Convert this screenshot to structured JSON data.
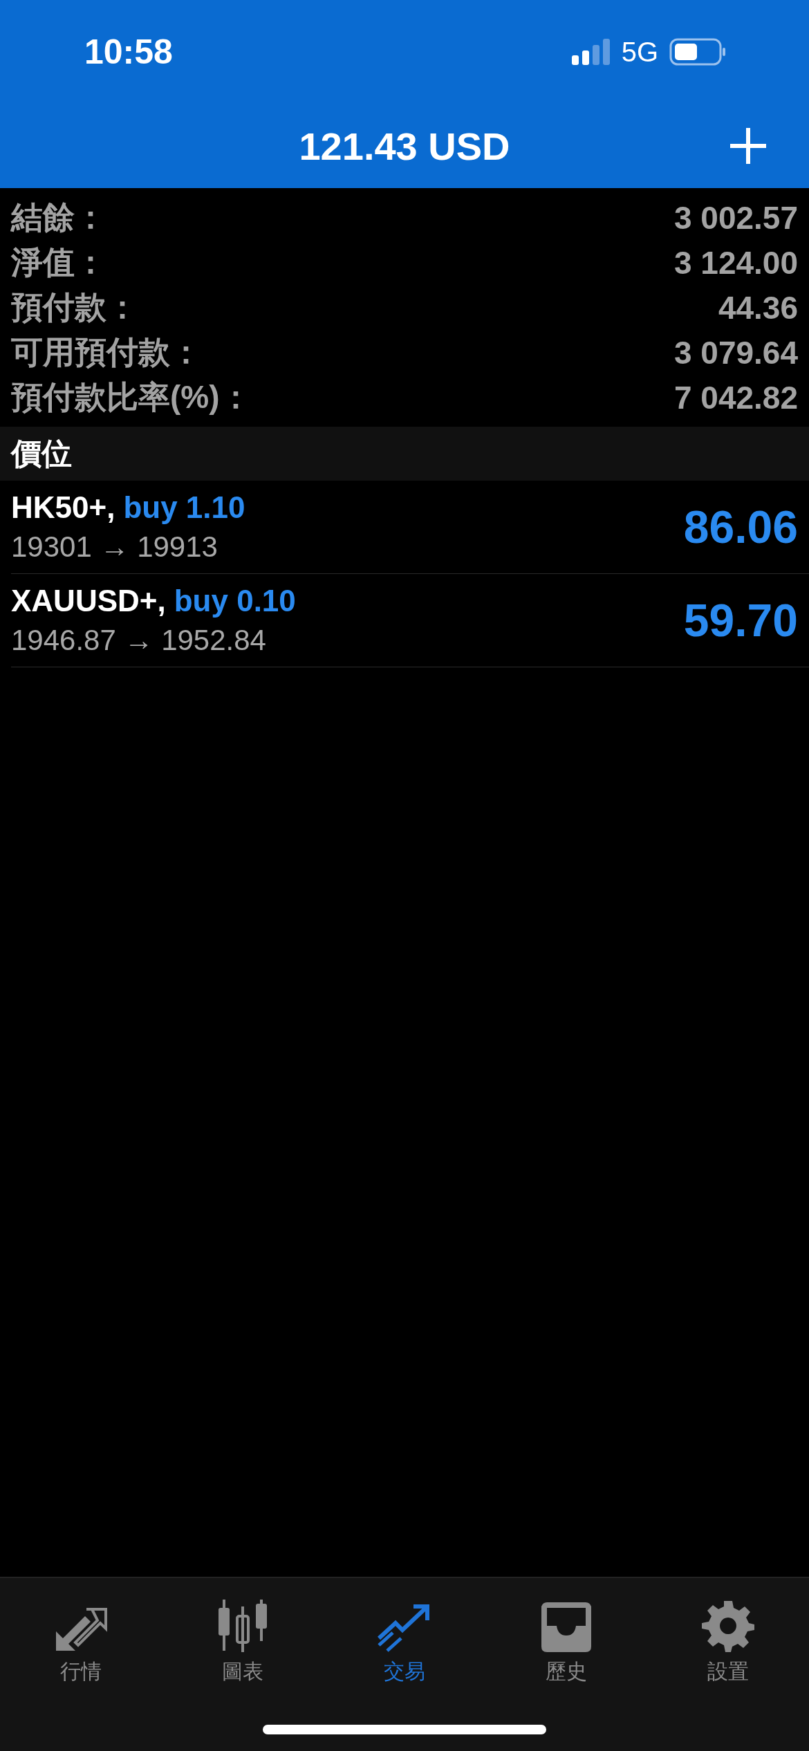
{
  "status_bar": {
    "time": "10:58",
    "network": "5G"
  },
  "header": {
    "title": "121.43 USD"
  },
  "account": [
    {
      "label": "結餘：",
      "value": "3 002.57"
    },
    {
      "label": "淨值：",
      "value": "3 124.00"
    },
    {
      "label": "預付款：",
      "value": "44.36"
    },
    {
      "label": "可用預付款：",
      "value": "3 079.64"
    },
    {
      "label": "預付款比率(%)：",
      "value": "7 042.82"
    }
  ],
  "positions": {
    "title": "價位",
    "items": [
      {
        "symbol": "HK50+,",
        "order": "buy 1.10",
        "prices": "19301 → 19913",
        "profit": "86.06"
      },
      {
        "symbol": "XAUUSD+,",
        "order": "buy 0.10",
        "prices": "1946.87 → 1952.84",
        "profit": "59.70"
      }
    ]
  },
  "tab_bar": [
    {
      "kind": "quotes",
      "label": "行情",
      "selected": false
    },
    {
      "kind": "chart",
      "label": "圖表",
      "selected": false
    },
    {
      "kind": "trade",
      "label": "交易",
      "selected": true
    },
    {
      "kind": "history",
      "label": "歷史",
      "selected": false
    },
    {
      "kind": "settings",
      "label": "設置",
      "selected": false
    }
  ]
}
